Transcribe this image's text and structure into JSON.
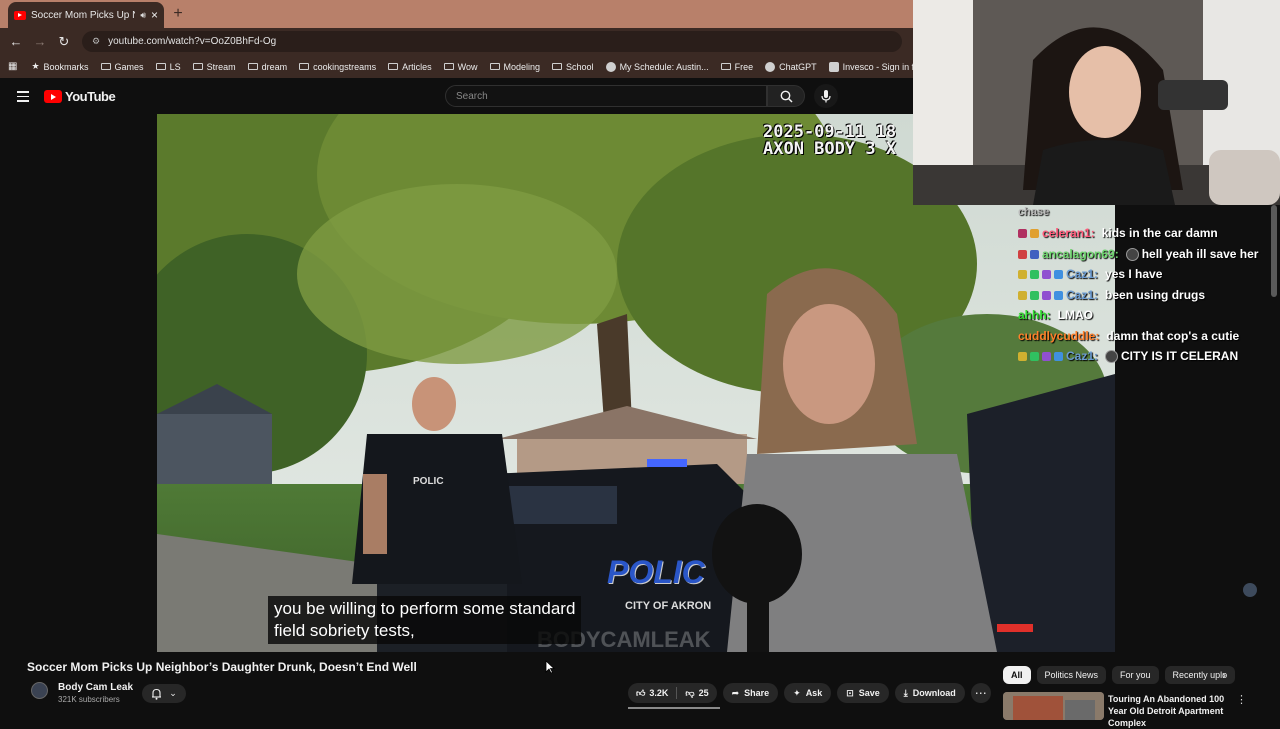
{
  "browser": {
    "tab_title": "Soccer Mom Picks Up Neig",
    "url": "youtube.com/watch?v=OoZ0BhFd-Og",
    "bookmarks": [
      "Bookmarks",
      "Games",
      "LS",
      "Stream",
      "dream",
      "cookingstreams",
      "Articles",
      "Wow",
      "Modeling",
      "School",
      "My Schedule: Austin...",
      "Free",
      "ChatGPT",
      "Invesco - Sign in for..."
    ]
  },
  "youtube": {
    "logo_text": "YouTube",
    "search_placeholder": "Search"
  },
  "video": {
    "timestamp_line1": "2025-09-11 18",
    "timestamp_line2": "AXON BODY 3 X",
    "caption_line1": "you be willing to perform some standard",
    "caption_line2": "field sobriety tests,",
    "car_text": "POLIC",
    "car_city": "CITY OF AKRON",
    "vest_text": "POLIC",
    "watermark": "BODYCAMLEAK"
  },
  "chat": {
    "top_fragment": "chase",
    "messages": [
      {
        "user": "celeran1:",
        "user_color": "#ff5a7a",
        "text": "kids in the car damn"
      },
      {
        "user": "ancalagon69:",
        "user_color": "#6fd66f",
        "text": "hell yeah ill save her"
      },
      {
        "user": "Caz1:",
        "user_color": "#6b9bd1",
        "text": "yes I have"
      },
      {
        "user": "Caz1:",
        "user_color": "#6b9bd1",
        "text": "been using drugs"
      },
      {
        "user": "ahhh:",
        "user_color": "#33dd33",
        "text": "LMAO"
      },
      {
        "user": "cuddlycuddle:",
        "user_color": "#ff7f2a",
        "text": "damn that cop's a cutie"
      },
      {
        "user": "Caz1:",
        "user_color": "#6b9bd1",
        "text": "CITY IS IT CELERAN"
      }
    ]
  },
  "below": {
    "title": "Soccer Mom Picks Up Neighbor’s Daughter Drunk, Doesn’t End Well",
    "channel": "Body Cam Leak",
    "subscribers": "321K subscribers",
    "likes": "3.2K",
    "dislikes": "25",
    "share": "Share",
    "ask": "Ask",
    "save": "Save",
    "download": "Download"
  },
  "chips": [
    "All",
    "Politics News",
    "For you",
    "Recently uplo"
  ],
  "recommendation": {
    "title": "Touring An Abandoned 100 Year Old Detroit Apartment Complex"
  },
  "colors": {
    "page_bg": "#0f0f0f",
    "chrome_tabstrip": "#b8806a",
    "chrome_toolbar": "#3b2a24",
    "youtube_red": "#ff0000"
  },
  "icons": [
    "back-icon",
    "forward-icon",
    "reload-icon",
    "site-info-icon",
    "apps-icon",
    "star-icon",
    "folder-icon",
    "hamburger-icon",
    "search-icon",
    "mic-icon",
    "bell-icon",
    "like-icon",
    "dislike-icon",
    "share-icon",
    "ask-icon",
    "save-icon",
    "download-icon",
    "more-icon",
    "chevron-right-icon"
  ]
}
